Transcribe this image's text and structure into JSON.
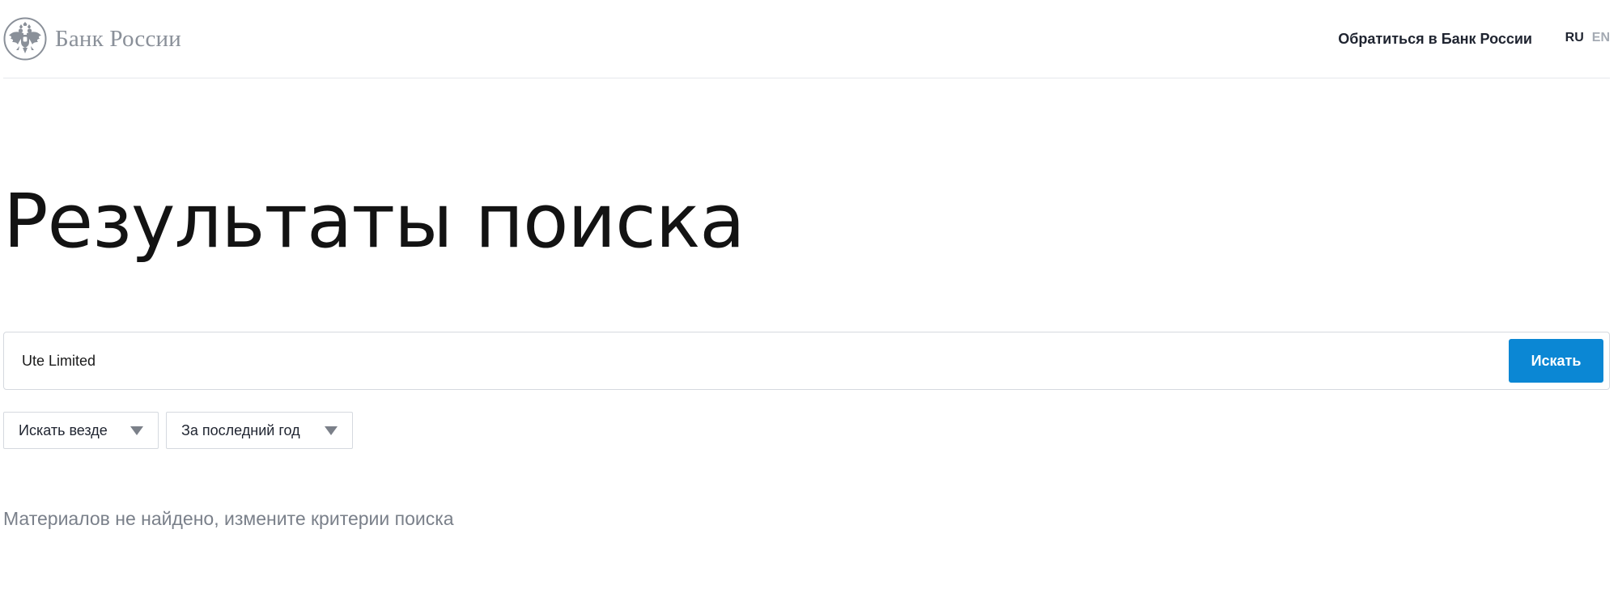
{
  "header": {
    "logo_text": "Банк России",
    "contact_label": "Обратиться в Банк России",
    "languages": {
      "ru": "RU",
      "en": "EN"
    },
    "active_language": "RU"
  },
  "main": {
    "title": "Результаты поиска",
    "search": {
      "value": "Ute Limited",
      "button_label": "Искать"
    },
    "filters": {
      "where": "Искать везде",
      "period": "За последний год"
    },
    "empty_message": "Материалов не найдено, измените критерии поиска"
  },
  "colors": {
    "accent": "#0b87d4",
    "logo_gray": "#8a9099",
    "muted_text": "#7a808a"
  },
  "icons": {
    "logo": "double-headed-eagle-emblem-icon",
    "dropdown": "caret-down-icon"
  }
}
